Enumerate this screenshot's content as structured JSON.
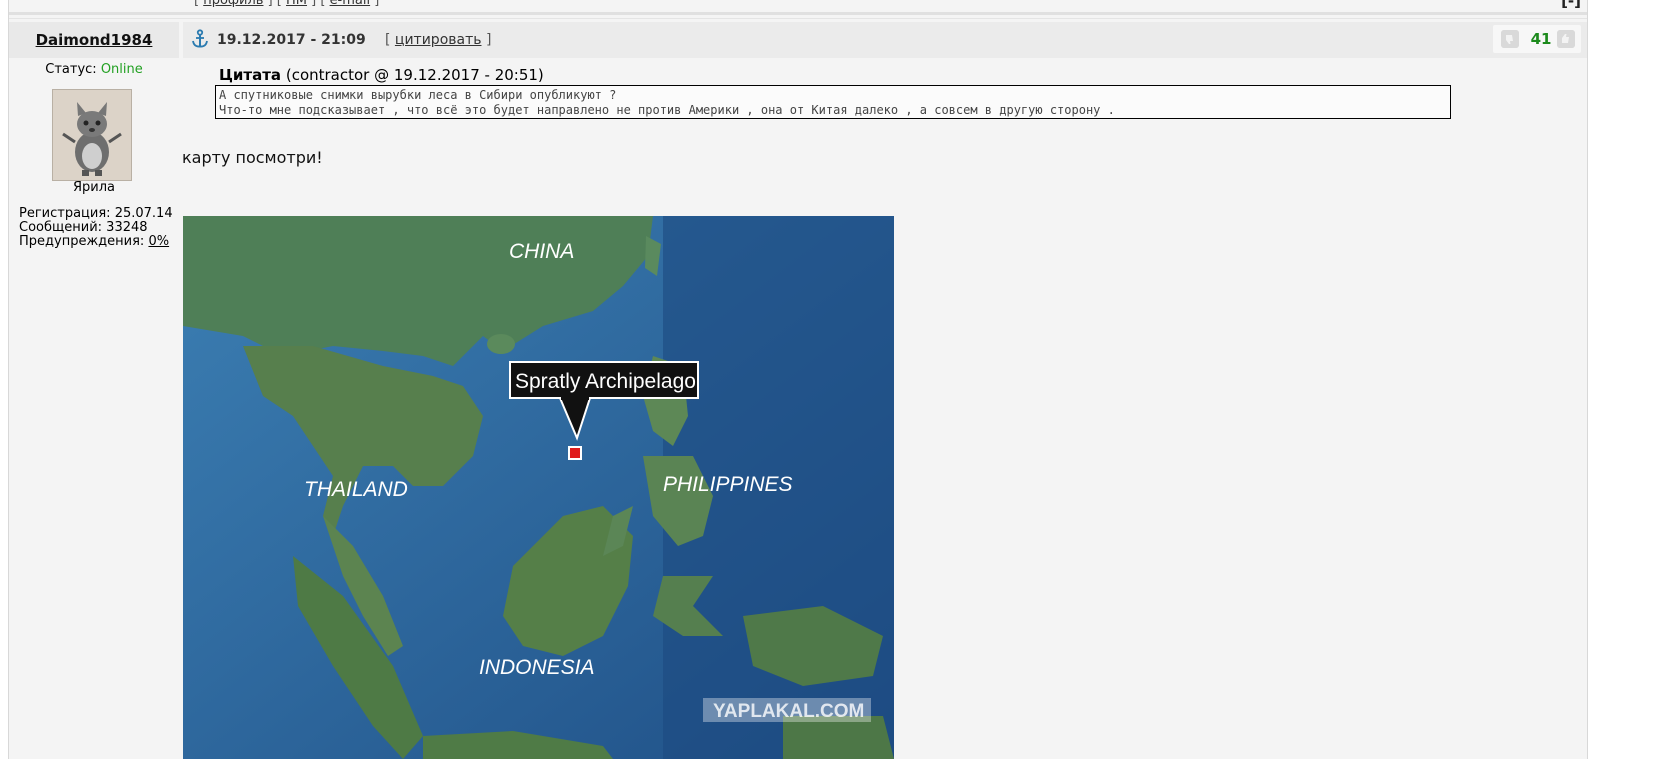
{
  "prev_post_links": {
    "profile": "профиль",
    "pm": "ПМ",
    "email": "e-mail",
    "collapse": "[-]"
  },
  "post": {
    "author": "Daimond1984",
    "date": "19.12.2017 - 21:09",
    "quote_link": "цитировать",
    "rating": "41",
    "user": {
      "status_label": "Статус:",
      "status_value": "Online",
      "rank": "Ярила",
      "registration_label": "Регистрация:",
      "registration_value": "25.07.14",
      "messages_label": "Сообщений:",
      "messages_value": "33248",
      "warnings_label": "Предупреждения:",
      "warnings_value": "0%"
    },
    "quote": {
      "label": "Цитата",
      "meta": "(contractor @ 19.12.2017 - 20:51)",
      "line1": "А спутниковые снимки вырубки леса в Сибири опубликуют ?",
      "line2": "Что-то мне подсказывает , что всё это будет направлено не против Америки , она от Китая далеко , а совсем в другую сторону ."
    },
    "text": "карту посмотри!",
    "image": {
      "labels": {
        "china": "CHINA",
        "thailand": "THAILAND",
        "philippines": "PHILIPPINES",
        "indonesia": "INDONESIA",
        "spratly": "Spratly Archipelago",
        "watermark": "YAPLAKAL.COM"
      }
    }
  },
  "colors": {
    "online": "#22a022",
    "rating": "#1c8a1c",
    "sea": "#2f6ea3"
  }
}
